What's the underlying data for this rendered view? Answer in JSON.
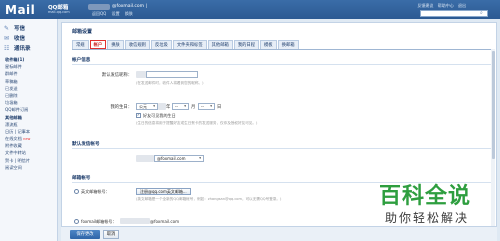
{
  "header": {
    "logo": "Mail",
    "logo_cn": "QQ邮箱",
    "logo_sub": "mail.qq.com",
    "email": "@foxmail.com",
    "email_sep": " |",
    "links": [
      "返回QQ",
      "设置",
      "换肤"
    ],
    "top_right_links": [
      "反馈建议",
      "帮助中心",
      "退出"
    ]
  },
  "sidebar": {
    "main_items": [
      {
        "label": "写信",
        "icon": "pencil-icon"
      },
      {
        "label": "收信",
        "icon": "inbox-icon"
      },
      {
        "label": "通讯录",
        "icon": "contacts-icon"
      }
    ],
    "folders": [
      {
        "label": "收件箱(1)",
        "head": true
      },
      {
        "label": "星标邮件"
      },
      {
        "label": "群邮件"
      },
      {
        "label": "草稿箱"
      },
      {
        "label": "已发送"
      },
      {
        "label": "已删除"
      },
      {
        "label": "垃圾箱"
      },
      {
        "label": "QQ邮件订阅"
      },
      {
        "label": "其他邮箱",
        "head": true
      },
      {
        "label": "漂流瓶"
      },
      {
        "label": "日历 | 记事本"
      },
      {
        "label": "在线文档"
      },
      {
        "label": "附件收藏"
      },
      {
        "label": "文件中转站"
      },
      {
        "label": "贺卡 | 明信片"
      },
      {
        "label": "阅读空间"
      }
    ],
    "new_badge": "new"
  },
  "main": {
    "page_title": "邮箱设置",
    "tabs": [
      {
        "label": "常规",
        "active": false
      },
      {
        "label": "帐户",
        "active": true
      },
      {
        "label": "换肤",
        "active": false
      },
      {
        "label": "收信规则",
        "active": false
      },
      {
        "label": "反垃圾",
        "active": false
      },
      {
        "label": "文件夹和标签",
        "active": false
      },
      {
        "label": "其他邮箱",
        "active": false
      },
      {
        "label": "我的日程",
        "active": false
      },
      {
        "label": "模板",
        "active": false
      },
      {
        "label": "换邮箱",
        "active": false
      }
    ],
    "account_info": {
      "title": "帐户信息",
      "nickname_label": "默认发信昵称：",
      "nickname_hint": "(在发送邮件时，收件人将看到您的昵称。)",
      "birthday_label": "我的生日：",
      "year_value": "公元",
      "month_value": "--",
      "day_value": "--",
      "year_unit": "年",
      "month_unit": "月",
      "day_unit": "日",
      "birthday_checkbox_label": "好友可见我的生日",
      "birthday_hint": "(生日的信息将用于提醒好友或生日贺卡的发送服务，仅你及授权好友可见。)"
    },
    "default_sender": {
      "title": "默认发信帐号",
      "sender_value": "@foxmail.com"
    },
    "mail_accounts": {
      "title": "邮箱帐号",
      "qq_label": "英文邮箱帐号：",
      "register_btn": "注册@qq.com英文邮箱...",
      "register_hint": "(英文邮箱是一个全新的QQ邮箱帐号，例如：zhangsan@qq.com，可以无需QQ号登录。)",
      "foxmail_label": "foxmail邮箱帐号：",
      "foxmail_value": "@foxmail.com"
    },
    "buttons": {
      "save": "保存更改",
      "cancel": "取消"
    }
  },
  "watermark": {
    "line1": "百科全说",
    "line2": "助你轻松解决"
  }
}
